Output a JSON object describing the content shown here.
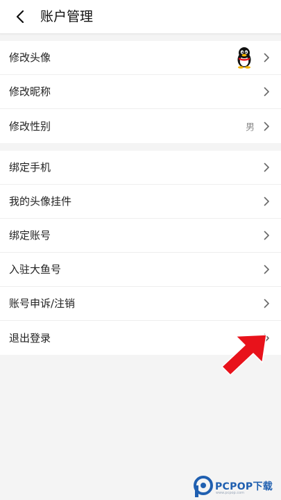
{
  "header": {
    "title": "账户管理"
  },
  "group1": [
    {
      "label": "修改头像",
      "value": ""
    },
    {
      "label": "修改昵称",
      "value": ""
    },
    {
      "label": "修改性别",
      "value": "男"
    }
  ],
  "group2": [
    {
      "label": "绑定手机"
    },
    {
      "label": "我的头像挂件"
    },
    {
      "label": "绑定账号"
    },
    {
      "label": "入驻大鱼号"
    },
    {
      "label": "账号申诉/注销"
    },
    {
      "label": "退出登录"
    }
  ],
  "watermark": {
    "brand": "PCPOP下载",
    "sub": "www.pcpop.com"
  },
  "colors": {
    "header_bg": "#ffffff",
    "page_bg": "#f4f4f4",
    "annotation": "#e8121b",
    "watermark": "#1f5fb0"
  }
}
